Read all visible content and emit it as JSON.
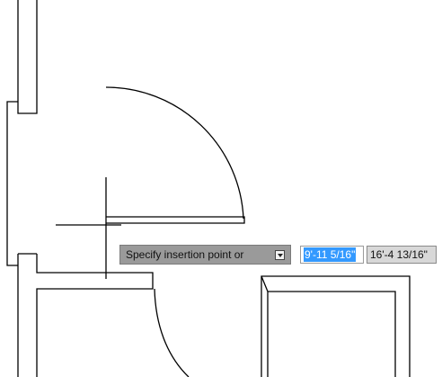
{
  "dynamic_input": {
    "prompt": "Specify insertion point or",
    "options_icon": "dropdown-arrow-icon",
    "x_value": "9'-11 5/16\"",
    "y_value": "16'-4 13/16\""
  },
  "colors": {
    "background": "#ffffff",
    "linework": "#000000",
    "prompt_bg": "#9a9a9a",
    "selection": "#3399ff"
  }
}
